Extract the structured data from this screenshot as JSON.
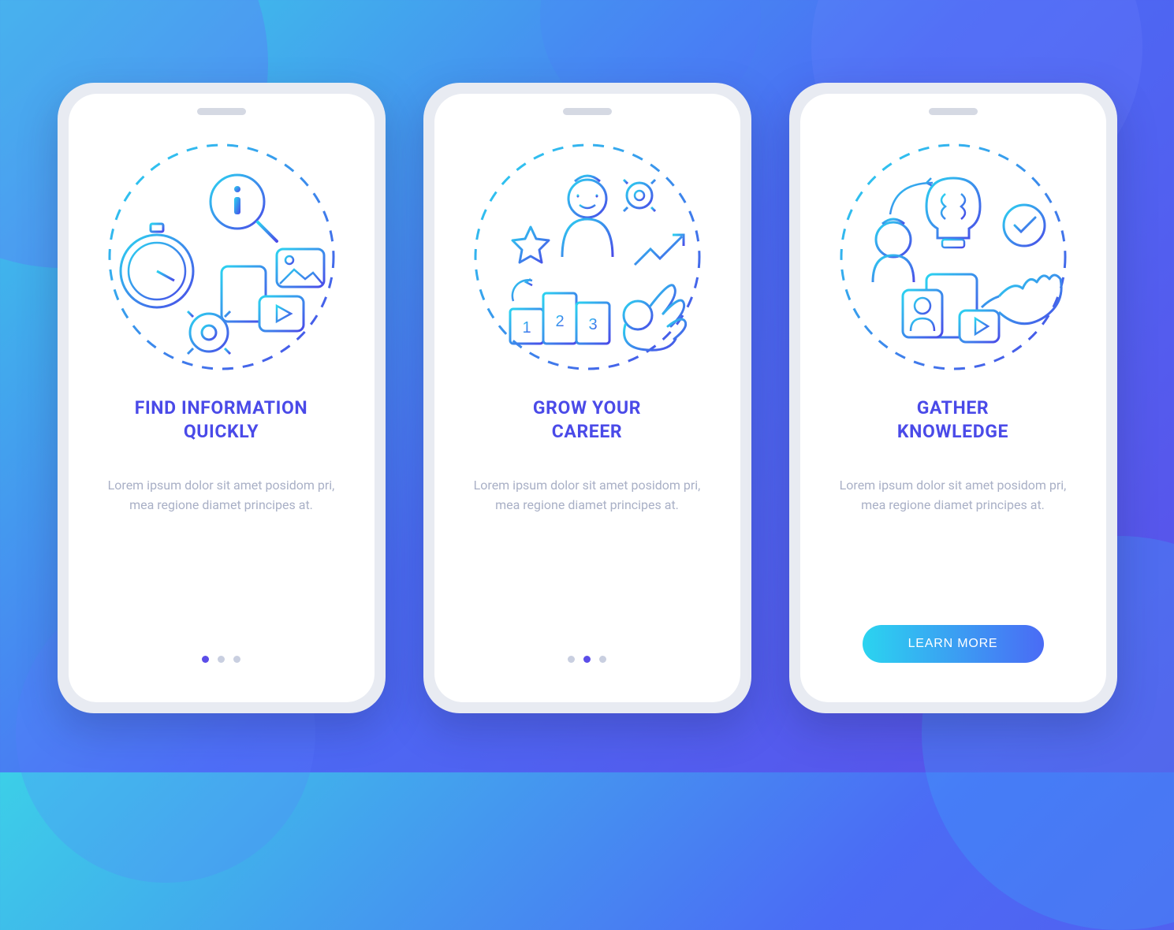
{
  "colors": {
    "title": "#4A4AE8",
    "dotActive": "#5B4DE8",
    "dotInactive": "#C9CFE0",
    "ctaGradientFrom": "#2BD4F0",
    "ctaGradientTo": "#4A6BF5"
  },
  "screens": [
    {
      "title": "FIND INFORMATION\nQUICKLY",
      "description": "Lorem ipsum dolor sit amet posidom pri, mea regione diamet principes at.",
      "activeDot": 0,
      "hasCta": false,
      "iconName": "find-info-illustration"
    },
    {
      "title": "GROW YOUR\nCAREER",
      "description": "Lorem ipsum dolor sit amet posidom pri, mea regione diamet principes at.",
      "activeDot": 1,
      "hasCta": false,
      "iconName": "grow-career-illustration"
    },
    {
      "title": "GATHER\nKNOWLEDGE",
      "description": "Lorem ipsum dolor sit amet posidom pri, mea regione diamet principes at.",
      "activeDot": 2,
      "hasCta": true,
      "iconName": "gather-knowledge-illustration"
    }
  ],
  "cta": {
    "label": "LEARN MORE"
  },
  "dotCount": 3
}
